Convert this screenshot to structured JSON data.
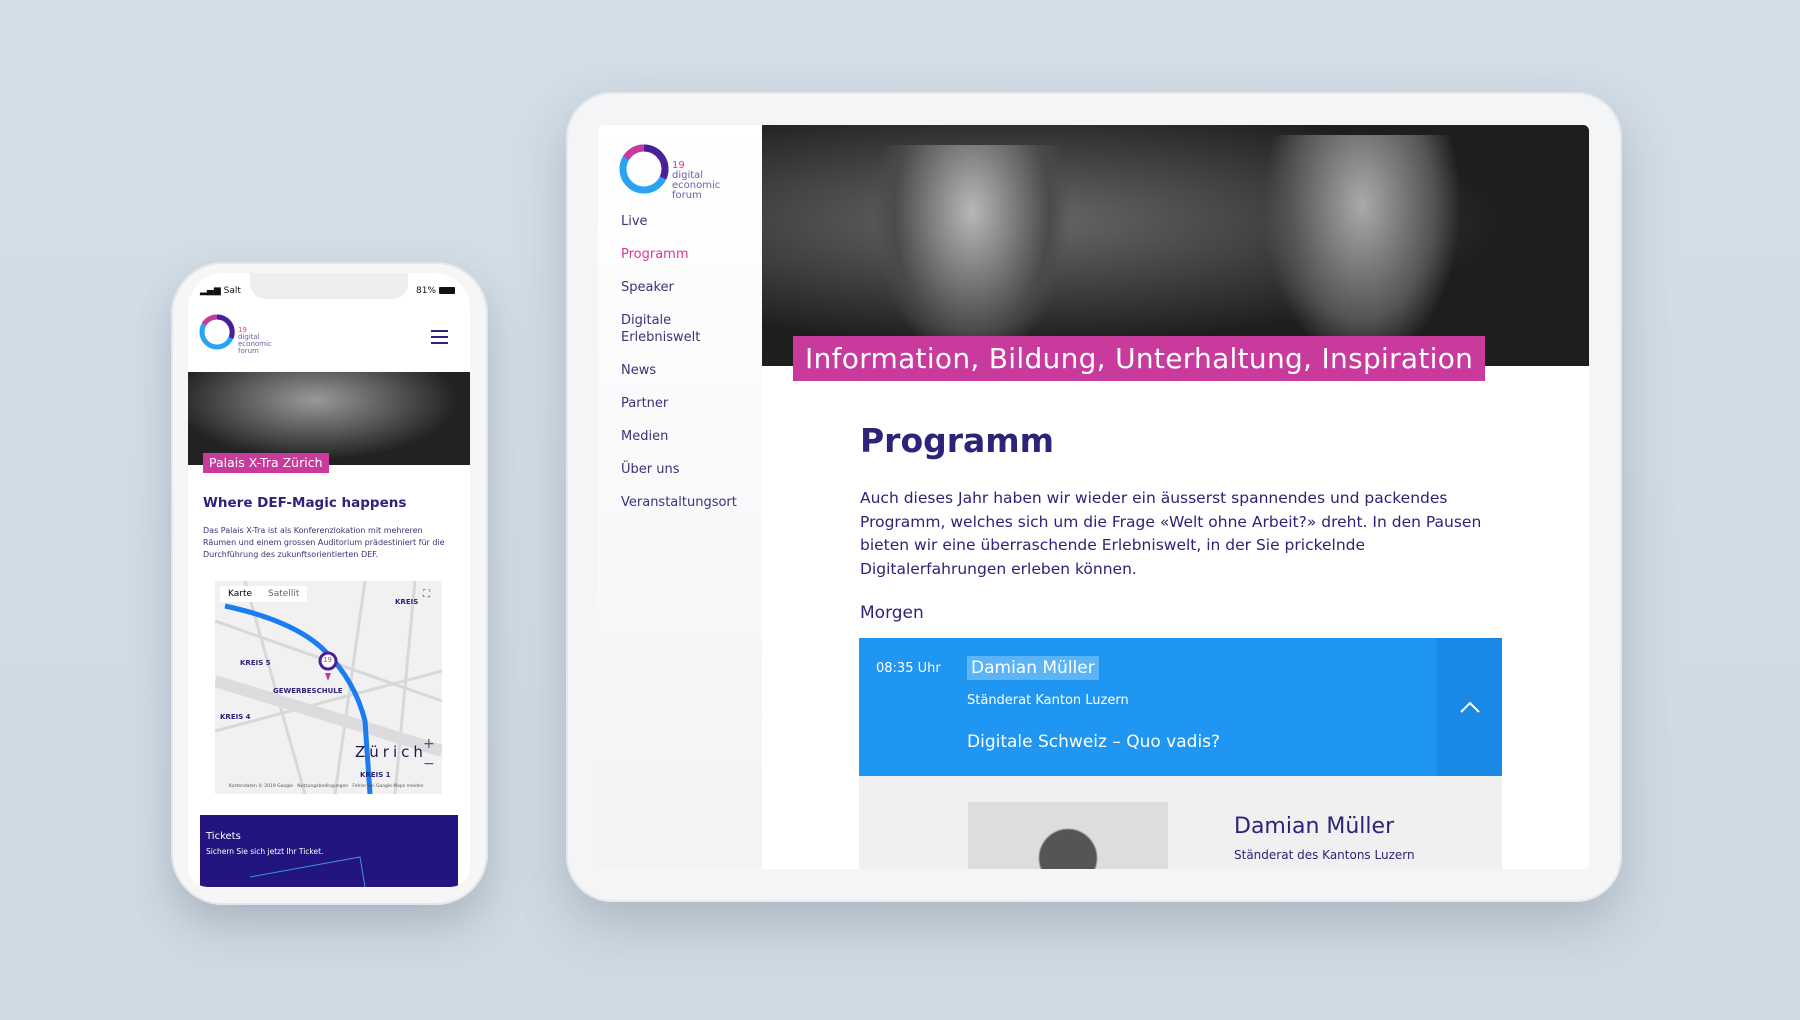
{
  "colors": {
    "brand_navy": "#2b2478",
    "accent_magenta": "#c83b9c",
    "accent_blue": "#1e96f2",
    "tickets_bg": "#22157f"
  },
  "logo": {
    "year": "19",
    "line1": "digital",
    "line2": "economic",
    "line3": "forum"
  },
  "tablet": {
    "nav": [
      {
        "label": "Live"
      },
      {
        "label": "Programm",
        "active": true
      },
      {
        "label": "Speaker"
      },
      {
        "label": "Digitale"
      },
      {
        "label": "Erlebniswelt"
      },
      {
        "label": "News"
      },
      {
        "label": "Partner"
      },
      {
        "label": "Medien"
      },
      {
        "label": "Über uns"
      },
      {
        "label": "Veranstaltungsort"
      }
    ],
    "hero_caption": "Information, Bildung, Unterhaltung, Inspiration",
    "title": "Programm",
    "intro": "Auch dieses Jahr haben wir wieder ein äusserst spannendes und packendes Programm, welches sich um die Frage «Welt ohne Arbeit?» dreht. In den Pausen bieten wir eine überraschende Erlebniswelt, in der Sie prickelnde Digitalerfahrungen erleben können.",
    "section": "Morgen",
    "session": {
      "time": "08:35 Uhr",
      "speaker": "Damian Müller",
      "role": "Ständerat Kanton Luzern",
      "talk": "Digitale Schweiz – Quo vadis?",
      "expand_icon": "chevron-up-icon"
    },
    "speaker_detail": {
      "name": "Damian Müller",
      "role": "Ständerat des Kantons Luzern"
    }
  },
  "phone": {
    "status": {
      "carrier": "Salt",
      "battery": "81%"
    },
    "menu_icon": "hamburger-icon",
    "hero_caption": "Palais X-Tra Zürich",
    "title": "Where DEF-Magic happens",
    "text": "Das Palais X-Tra ist als Konferenzlokation mit mehreren Räumen und einem grossen Auditorium prädestiniert für die Durchführung des zukunftsorientierten DEF.",
    "map": {
      "tab_map": "Karte",
      "tab_satellite": "Satellit",
      "labels": [
        "KREIS 5",
        "GEWERBESCHULE",
        "KREIS 4",
        "Zürich",
        "KREIS 1",
        "KREIS"
      ],
      "pin": "19",
      "footer": "Kartendaten © 2019 Google   Nutzungsbedingungen   Fehler bei Google Maps melden",
      "zoom_in": "+",
      "zoom_out": "−"
    },
    "tickets": {
      "title": "Tickets",
      "text": "Sichern Sie sich jetzt Ihr Ticket."
    }
  }
}
